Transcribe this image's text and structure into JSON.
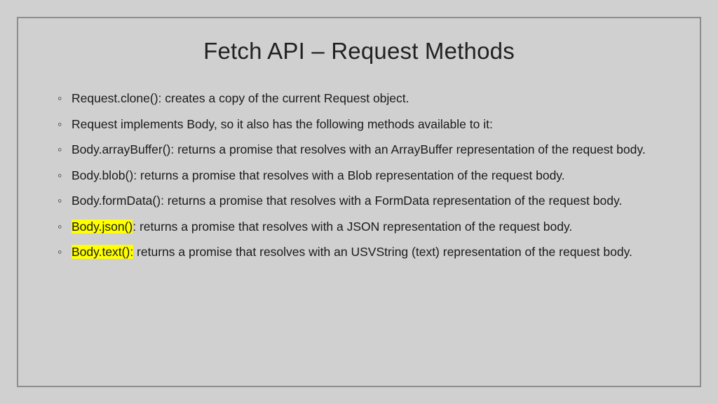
{
  "title": "Fetch API – Request Methods",
  "bullets": [
    {
      "highlight": "",
      "rest": "Request.clone(): creates a copy of the current Request object."
    },
    {
      "highlight": "",
      "rest": "Request implements Body, so it also has the following methods available to it:"
    },
    {
      "highlight": "",
      "rest": "Body.arrayBuffer(): returns a promise that resolves with an ArrayBuffer representation of the request body."
    },
    {
      "highlight": "",
      "rest": "Body.blob(): returns a promise that resolves with a Blob representation of the request body."
    },
    {
      "highlight": "",
      "rest": "Body.formData(): returns a promise that resolves with a FormData representation of the request body."
    },
    {
      "highlight": "Body.json()",
      "rest": ": returns a promise that resolves with a JSON representation of the request body."
    },
    {
      "highlight": "Body.text():",
      "rest": " returns a promise that resolves with an USVString (text) representation of the request body."
    }
  ]
}
